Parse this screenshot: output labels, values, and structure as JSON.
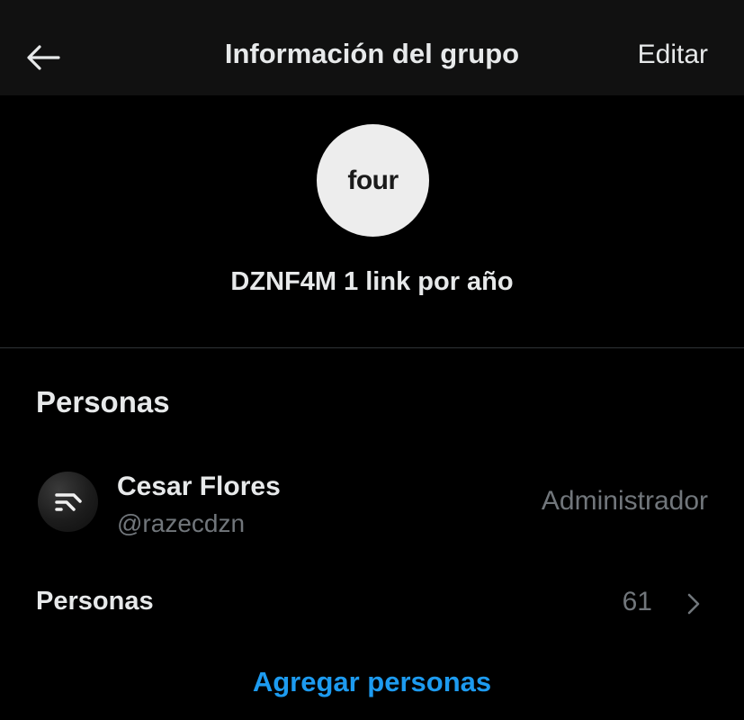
{
  "header": {
    "title": "Información del grupo",
    "edit_label": "Editar",
    "back_icon": "arrow-left-icon"
  },
  "group": {
    "avatar_text": "four",
    "name": "DZNF4M 1 link por año"
  },
  "people_section": {
    "title": "Personas",
    "members": [
      {
        "name": "Cesar Flores",
        "handle": "@razecdzn",
        "role": "Administrador",
        "avatar_icon": "dzn-logo-icon"
      }
    ],
    "people_row": {
      "label": "Personas",
      "count": "61"
    },
    "add_people_label": "Agregar personas"
  },
  "colors": {
    "background": "#000000",
    "header_background": "#111111",
    "primary_text": "#e7e9ea",
    "secondary_text": "#71767b",
    "accent": "#1d9bf0",
    "divider": "#2f3336"
  }
}
